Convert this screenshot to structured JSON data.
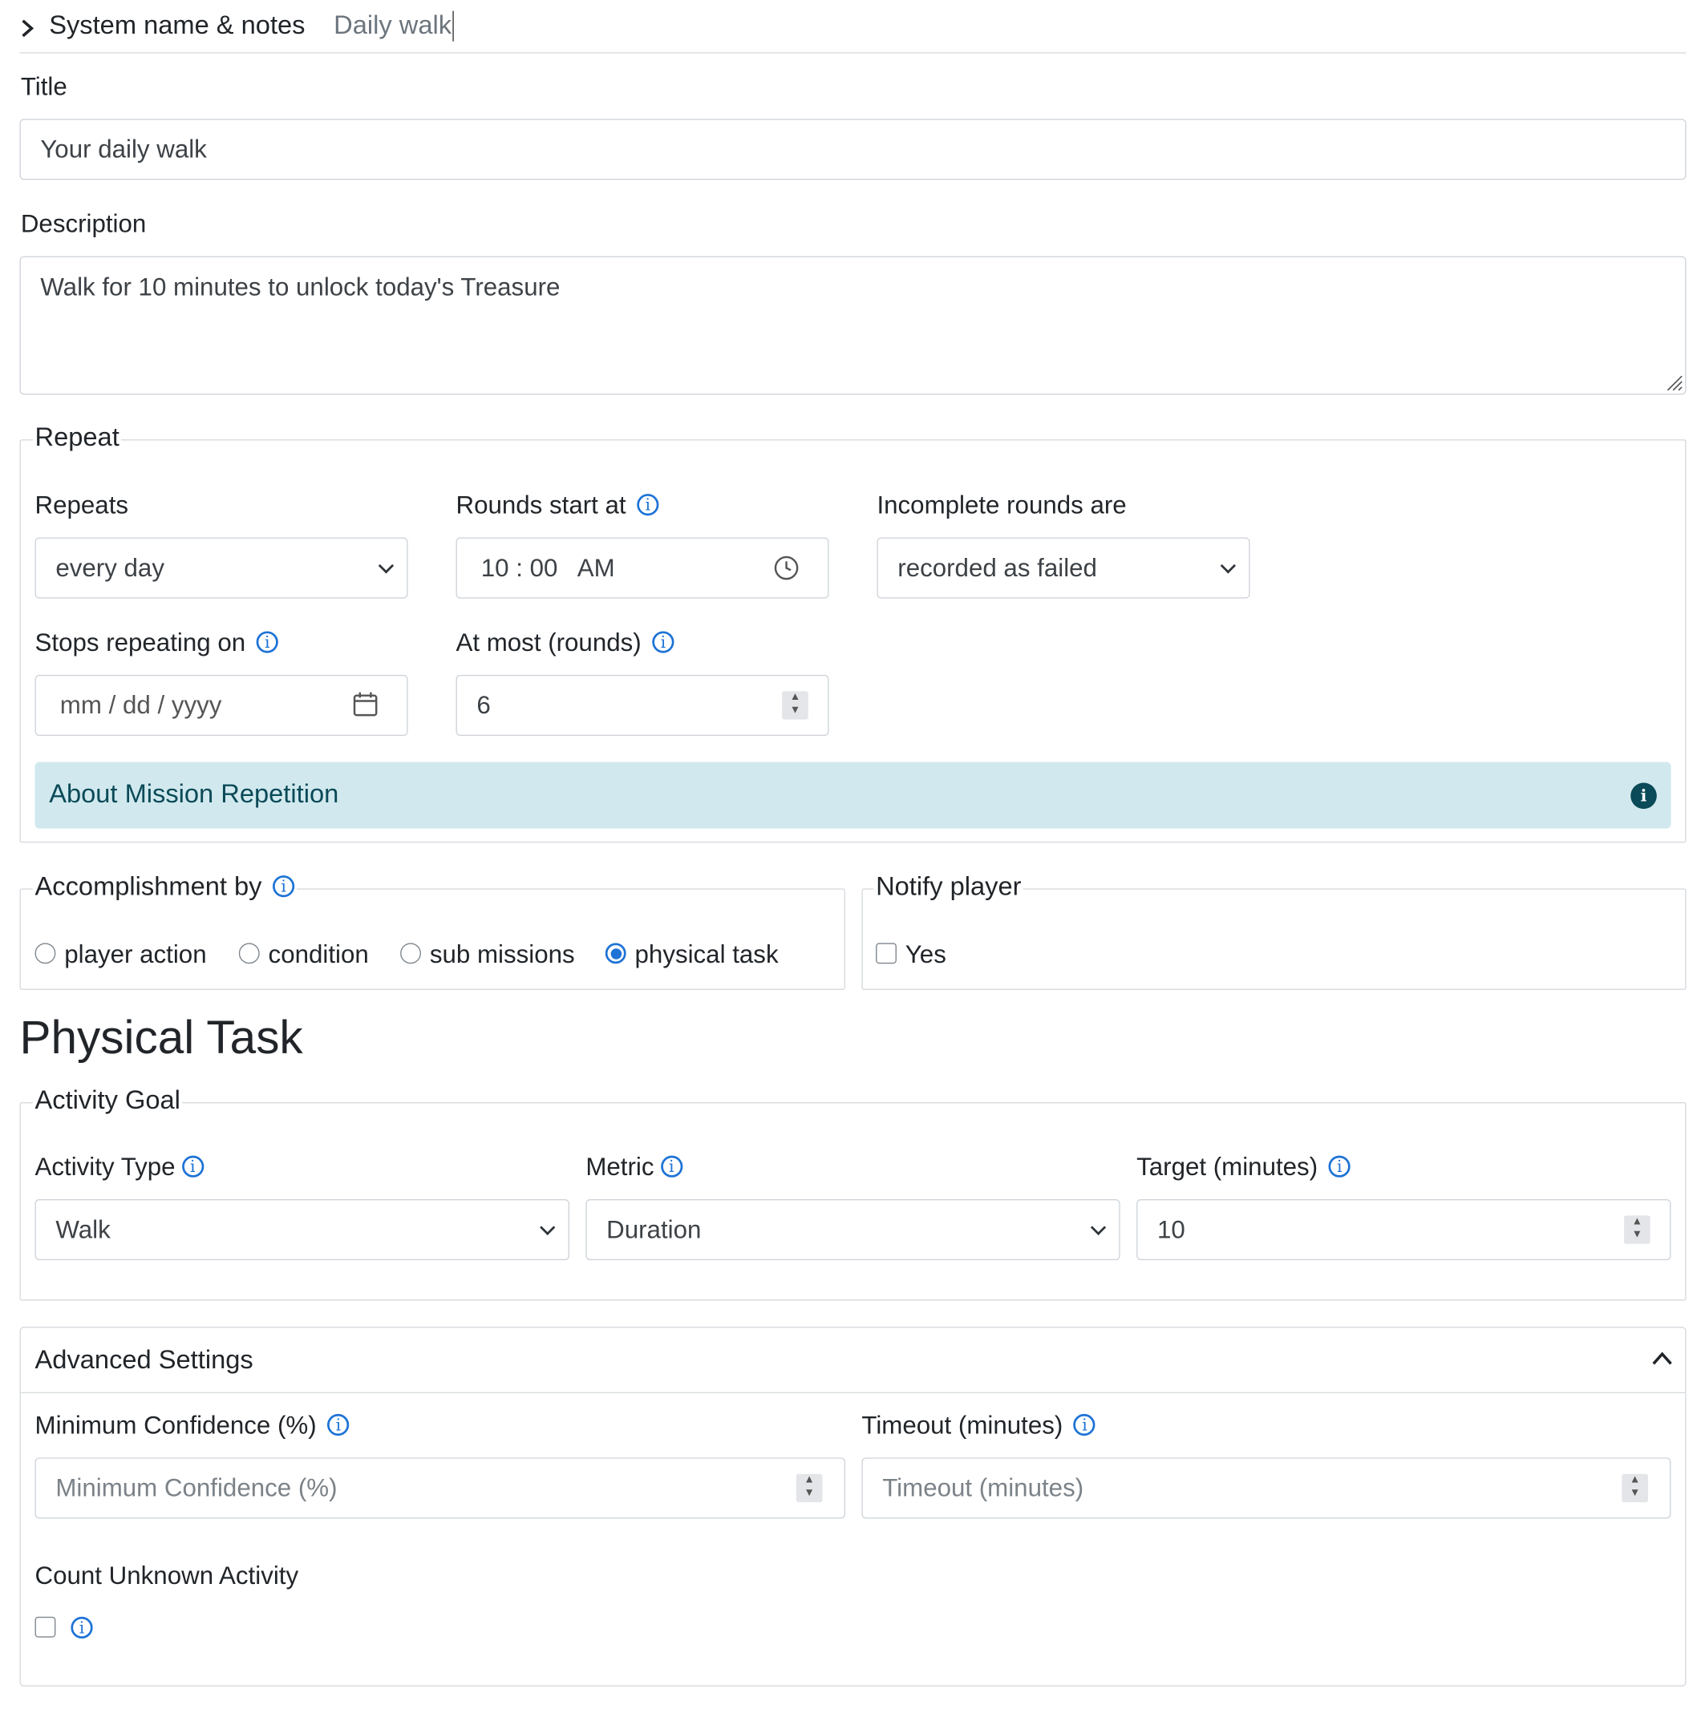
{
  "system": {
    "label": "System name & notes",
    "value": "Daily walk"
  },
  "title_field": {
    "label": "Title",
    "value": "Your daily walk"
  },
  "description_field": {
    "label": "Description",
    "value": "Walk for 10 minutes to unlock today's Treasure"
  },
  "repeat": {
    "legend": "Repeat",
    "repeats": {
      "label": "Repeats",
      "value": "every day"
    },
    "rounds_start": {
      "label": "Rounds start at",
      "hour": "10",
      "minute": "00",
      "ampm": "AM"
    },
    "incomplete": {
      "label": "Incomplete rounds are",
      "value": "recorded as failed"
    },
    "stops": {
      "label": "Stops repeating on",
      "placeholder": "mm / dd / yyyy"
    },
    "at_most": {
      "label": "At most (rounds)",
      "value": "6"
    },
    "about": "About Mission Repetition"
  },
  "accomplishment": {
    "legend": "Accomplishment by",
    "options": [
      "player action",
      "condition",
      "sub missions",
      "physical task"
    ],
    "selected": "physical task"
  },
  "notify": {
    "legend": "Notify player",
    "option": "Yes",
    "checked": false
  },
  "physical_task": {
    "heading": "Physical Task",
    "legend": "Activity Goal",
    "activity_type": {
      "label": "Activity Type",
      "value": "Walk"
    },
    "metric": {
      "label": "Metric",
      "value": "Duration"
    },
    "target": {
      "label": "Target (minutes)",
      "value": "10"
    }
  },
  "advanced": {
    "title": "Advanced Settings",
    "min_confidence": {
      "label": "Minimum Confidence (%)",
      "placeholder": "Minimum Confidence (%)"
    },
    "timeout": {
      "label": "Timeout (minutes)",
      "placeholder": "Timeout (minutes)"
    },
    "count_unknown": {
      "label": "Count Unknown Activity",
      "checked": false
    }
  },
  "colors": {
    "accent": "#1d73d6",
    "alert_bg": "#d1e9ee",
    "alert_text": "#0b4a58"
  },
  "icons": {
    "expand": "chevron-right-icon",
    "collapse": "chevron-up-icon",
    "info": "info-icon",
    "clock": "clock-icon",
    "calendar": "calendar-icon"
  }
}
